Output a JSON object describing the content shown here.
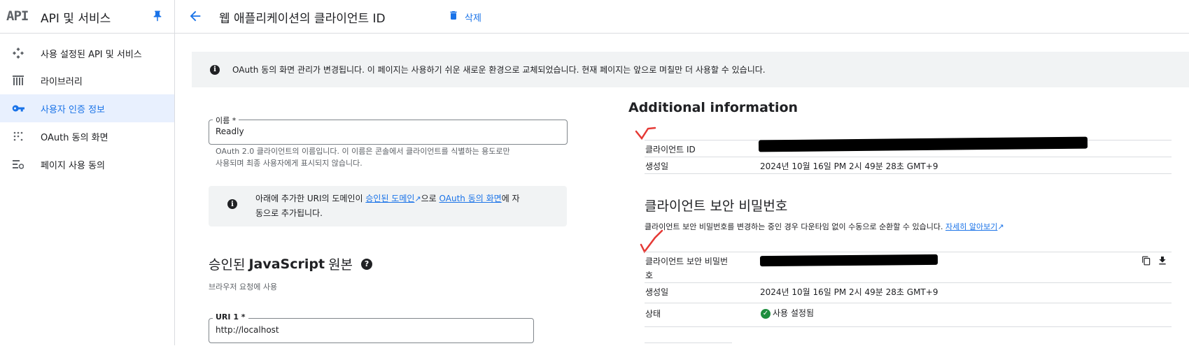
{
  "header": {
    "logo": "API",
    "product_title": "API 및 서비스",
    "page_title": "웹 애플리케이션의 클라이언트 ID",
    "delete_label": "삭제"
  },
  "sidebar": {
    "items": [
      {
        "label": "사용 설정된 API 및 서비스",
        "icon": "hub-icon",
        "active": false
      },
      {
        "label": "라이브러리",
        "icon": "library-icon",
        "active": false
      },
      {
        "label": "사용자 인증 정보",
        "icon": "key-icon",
        "active": true
      },
      {
        "label": "OAuth 동의 화면",
        "icon": "dots-grid-icon",
        "active": false
      },
      {
        "label": "페이지 사용 동의",
        "icon": "settings-list-icon",
        "active": false
      }
    ]
  },
  "banner": {
    "text": "OAuth 동의 화면 관리가 변경됩니다. 이 페이지는 사용하기 쉬운 새로운 환경으로 교체되었습니다. 현재 페이지는 앞으로 며칠만 더 사용할 수 있습니다."
  },
  "name_field": {
    "label": "이름 *",
    "value": "Readly",
    "helper_line1": "OAuth 2.0 클라이언트의 이름입니다. 이 이름은 콘솔에서 클라이언트를 식별하는 용도로만",
    "helper_line2": "사용되며 최종 사용자에게 표시되지 않습니다."
  },
  "notice": {
    "part1": "아래에 추가한 URI의 도메인이 ",
    "link1": "승인된 도메인",
    "part2": "으로 ",
    "link2": "OAuth 동의 화면",
    "part3": "에 자",
    "line2": "동으로 추가됩니다."
  },
  "js_origins": {
    "title_prefix": "승인된 ",
    "title_bold": "JavaScript",
    "title_suffix": " 원본",
    "subtitle": "브라우저 요청에 사용",
    "uri_label": "URI 1 *",
    "uri_value": "http://localhost"
  },
  "additional_info": {
    "title": "Additional information",
    "client_id_label": "클라이언트 ID",
    "created_label": "생성일",
    "created_value": "2024년 10월 16일 PM 2시 49분 28초 GMT+9"
  },
  "secret": {
    "title": "클라이언트 보안 비밀번호",
    "desc": "클라이언트 보안 비밀번호를 변경하는 중인 경우 다운타임 없이 수동으로 순환할 수 있습니다.",
    "learn_more": "자세히 알아보기",
    "secret_label_line1": "클라이언트 보안 비밀번",
    "secret_label_line2": "호",
    "created_label": "생성일",
    "created_value": "2024년 10월 16일 PM 2시 49분 28초 GMT+9",
    "status_label": "상태",
    "status_value": "사용 설정됨"
  },
  "colors": {
    "accent": "#1a73e8",
    "active_bg": "#e8f0fe",
    "banner_bg": "#f1f3f4",
    "success": "#1e8e3e",
    "annotation": "#e53935"
  }
}
